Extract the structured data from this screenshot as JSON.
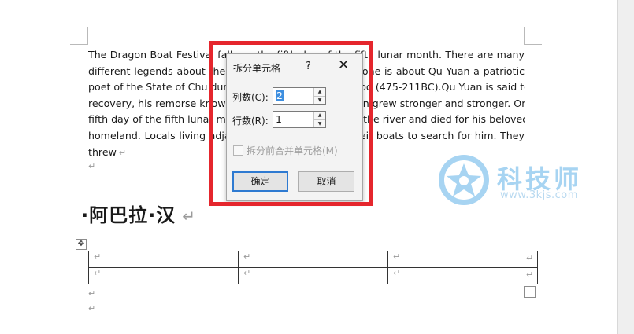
{
  "document": {
    "paragraph_lines": [
      "The Dragon Boat Festival falls on the fifth day of the fifth lunar month. There are many",
      "different legends about the festival, the most popular one is about Qu Yuan a patriotic",
      "poet of the State of Chu during the Warring States Period (475-211BC).Qu Yuan is said to",
      "recovery, his remorse knowing that the enemy state Qin grew stronger and stronger. On the",
      "fifth day of the fifth lunar month, he threw himself into the river and died for his beloved",
      "homeland. Locals living adjacent to the river rowed their boats to search for him. They",
      "threw"
    ],
    "heading": "·阿巴拉·汉",
    "paragraph_mark": "↵",
    "table": {
      "rows": 2,
      "cols": 3
    }
  },
  "dialog": {
    "title": "拆分单元格",
    "help": "?",
    "close": "✕",
    "columns_label": "列数(C):",
    "columns_value": "2",
    "rows_label": "行数(R):",
    "rows_value": "1",
    "merge_label": "拆分前合并单元格(M)",
    "ok_label": "确定",
    "cancel_label": "取消",
    "spin_up": "▲",
    "spin_down": "▼"
  },
  "watermark": {
    "title": "科技师",
    "url": "www.3kjs.com"
  },
  "colors": {
    "highlight": "#e5262d",
    "accent": "#2e7ad1",
    "watermark": "#a7d4f2"
  }
}
